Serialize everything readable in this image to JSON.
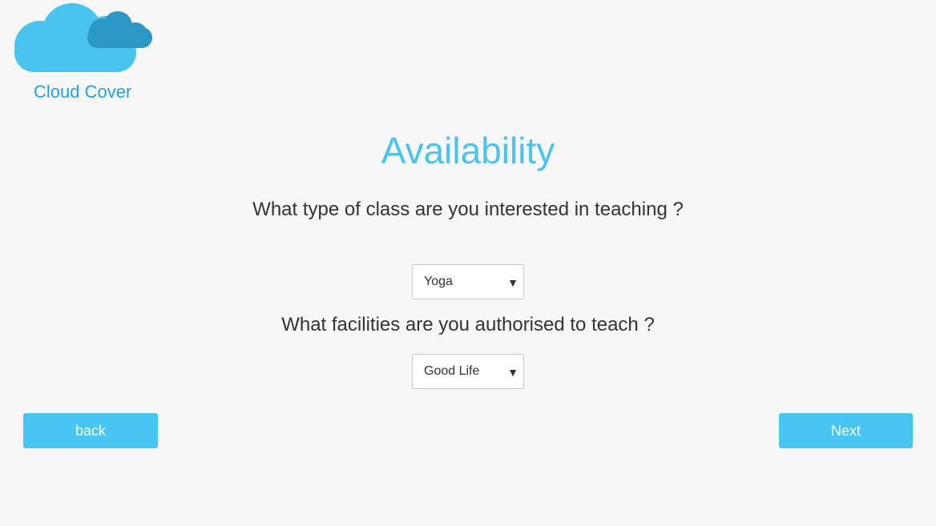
{
  "brand": {
    "name": "Cloud Cover",
    "logo_icon": "cloud-icon",
    "colors": {
      "cloud_light": "#4ac3ee",
      "cloud_dark": "#2c97c4",
      "text": "#2a9fd6"
    }
  },
  "page": {
    "title": "Availability"
  },
  "questions": [
    {
      "label": "What type of class are you interested in teaching ?",
      "selected": "Yoga"
    },
    {
      "label": "What facilities are you authorised to teach ?",
      "selected": "Good Life"
    }
  ],
  "buttons": {
    "back": "back",
    "next": "Next"
  },
  "colors": {
    "accent": "#48c5f0",
    "background": "#f7f7f7"
  }
}
